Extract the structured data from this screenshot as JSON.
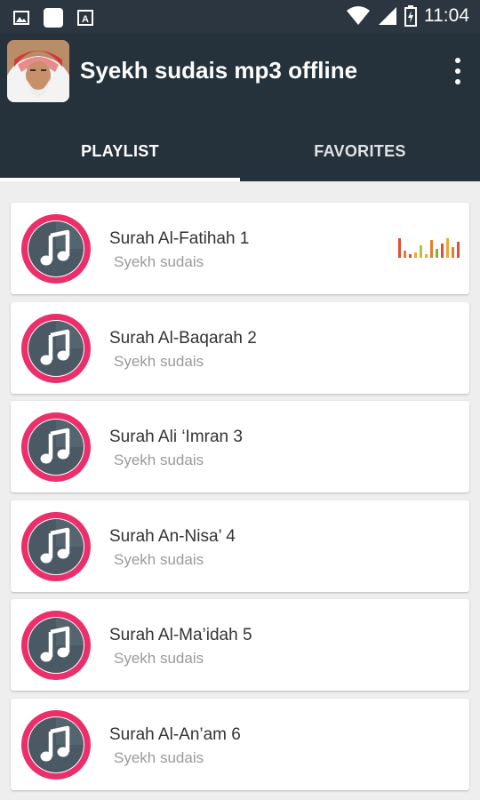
{
  "status_bar": {
    "time": "11:04",
    "left_icons": [
      "image-icon",
      "notification-square-icon",
      "text-a-icon"
    ],
    "right_icons": [
      "wifi-icon",
      "signal-icon",
      "battery-charging-icon"
    ]
  },
  "app_bar": {
    "title": "Syekh sudais mp3 offline",
    "menu_icon": "more-vert-icon"
  },
  "tabs": [
    {
      "label": "PLAYLIST",
      "active": true
    },
    {
      "label": "FAVORITES",
      "active": false
    }
  ],
  "playlist": [
    {
      "title": "Surah Al-Fatihah 1",
      "artist": "Syekh sudais",
      "playing": true
    },
    {
      "title": "Surah Al-Baqarah 2",
      "artist": "Syekh sudais",
      "playing": false
    },
    {
      "title": "Surah Ali ‘Imran 3",
      "artist": "Syekh sudais",
      "playing": false
    },
    {
      "title": "Surah An-Nisa’ 4",
      "artist": "Syekh sudais",
      "playing": false
    },
    {
      "title": "Surah Al-Ma’idah 5",
      "artist": "Syekh sudais",
      "playing": false
    },
    {
      "title": "Surah Al-An’am 6",
      "artist": "Syekh sudais",
      "playing": false
    }
  ],
  "colors": {
    "status_bar": "#2b3640",
    "app_bar": "#25313b",
    "accent": "#ec2f6b",
    "disc_dark": "#4a5964"
  }
}
